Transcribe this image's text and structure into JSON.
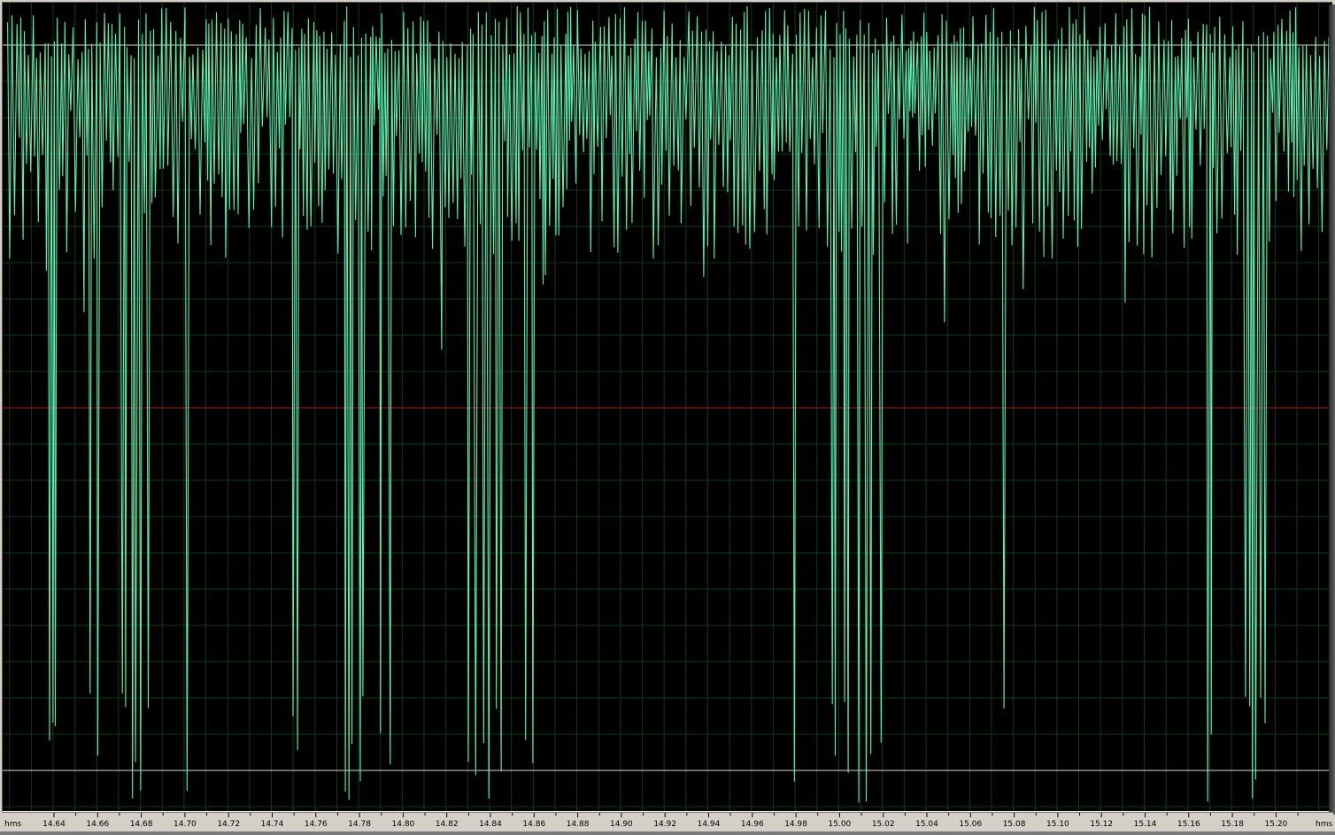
{
  "ruler": {
    "unit_label_left": "hms",
    "unit_label_right": "hms",
    "ticks": [
      "14.64",
      "14.66",
      "14.68",
      "14.70",
      "14.72",
      "14.74",
      "14.76",
      "14.78",
      "14.80",
      "14.82",
      "14.84",
      "14.86",
      "14.88",
      "14.90",
      "14.92",
      "14.94",
      "14.96",
      "14.98",
      "15.00",
      "15.02",
      "15.04",
      "15.06",
      "15.08",
      "15.10",
      "15.12",
      "15.14",
      "15.16",
      "15.18",
      "15.20"
    ]
  },
  "colors": {
    "background": "#000000",
    "waveform": "#5cf0b0",
    "grid": "#0f3a22",
    "center_line": "#b41a1a",
    "clip_lines": "#d8d8d8",
    "ruler_bg": "#d4d0c8"
  },
  "icons": {
    "waveform": "audio-waveform"
  }
}
